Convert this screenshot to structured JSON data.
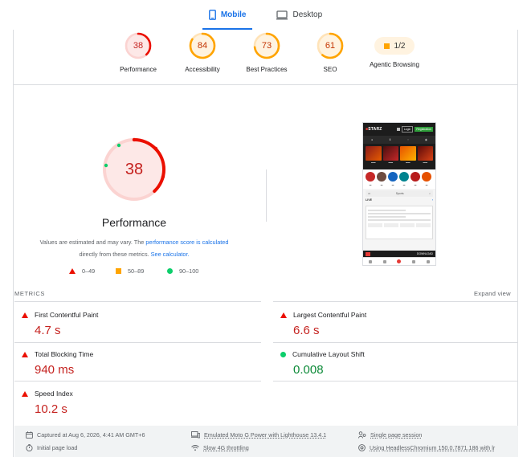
{
  "tabs": [
    {
      "label": "Mobile",
      "icon": "mobile-icon",
      "active": true
    },
    {
      "label": "Desktop",
      "icon": "desktop-icon",
      "active": false
    }
  ],
  "categories": [
    {
      "label": "Performance",
      "score": "38",
      "color": "#eb0f00",
      "fill": 0.38
    },
    {
      "label": "Accessibility",
      "score": "84",
      "color": "#ffa400",
      "fill": 0.84
    },
    {
      "label": "Best Practices",
      "score": "73",
      "color": "#ffa400",
      "fill": 0.73
    },
    {
      "label": "SEO",
      "score": "61",
      "color": "#ffa400",
      "fill": 0.61
    },
    {
      "label": "Agentic Browsing",
      "score": "1/2",
      "color": "#ffa400"
    }
  ],
  "performance": {
    "score": "38",
    "title": "Performance",
    "fill": 0.38,
    "note_prefix": "Values are estimated and may vary. The ",
    "note_link1": "performance score is calculated",
    "note_middle": " directly from these metrics. ",
    "note_link2": "See calculator."
  },
  "legend": [
    {
      "range": "0–49",
      "shape": "triangle",
      "color": "#eb0f00"
    },
    {
      "range": "50–89",
      "shape": "square",
      "color": "#ffa400"
    },
    {
      "range": "90–100",
      "shape": "circle",
      "color": "#0cce6b"
    }
  ],
  "phone": {
    "logo_text": "STARZ",
    "login": "Login",
    "register": "Registration",
    "search": "Sports",
    "live": "LIVE",
    "download": "DOWNLOAD"
  },
  "metrics": {
    "title": "METRICS",
    "expand": "Expand view",
    "items": [
      {
        "name": "First Contentful Paint",
        "value": "4.7 s",
        "status": "bad"
      },
      {
        "name": "Largest Contentful Paint",
        "value": "6.6 s",
        "status": "bad"
      },
      {
        "name": "Total Blocking Time",
        "value": "940 ms",
        "status": "bad"
      },
      {
        "name": "Cumulative Layout Shift",
        "value": "0.008",
        "status": "good"
      },
      {
        "name": "Speed Index",
        "value": "10.2 s",
        "status": "bad"
      }
    ]
  },
  "footer": {
    "captured": "Captured at Aug 6, 2026, 4:41 AM GMT+6",
    "device": "Emulated Moto G Power with Lighthouse 13.4.1",
    "session": "Single page session",
    "load": "Initial page load",
    "throttling": "Slow 4G throttling",
    "browser": "Using HeadlessChromium 150.0.7871.186 with lr"
  }
}
